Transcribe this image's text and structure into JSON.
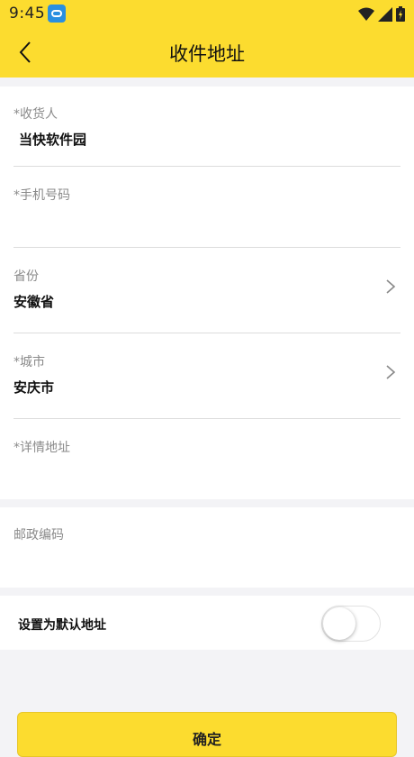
{
  "status_bar": {
    "time": "9:45",
    "app_icon": "app-notification-icon"
  },
  "header": {
    "title": "收件地址",
    "back_icon": "chevron-left-icon"
  },
  "form": {
    "receiver_label": "*收货人",
    "receiver_value": "当快软件园",
    "phone_label": "*手机号码",
    "phone_value": "",
    "province_label": "省份",
    "province_value": "安徽省",
    "city_label": "*城市",
    "city_value": "安庆市",
    "address_label": "*详情地址",
    "address_value": "",
    "postcode_label": "邮政编码",
    "postcode_value": "",
    "default_label": "设置为默认地址",
    "default_enabled": false
  },
  "confirm_label": "确定",
  "colors": {
    "accent": "#fcdc2f",
    "background": "#f3f3f6"
  }
}
